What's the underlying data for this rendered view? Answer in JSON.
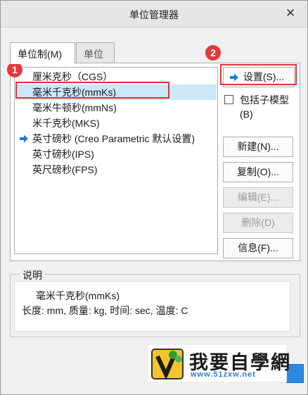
{
  "dialog": {
    "title": "单位管理器"
  },
  "tabs": [
    {
      "label": "单位制(M)",
      "active": true
    },
    {
      "label": "单位",
      "active": false
    }
  ],
  "unit_systems": [
    {
      "label": "厘米克秒（CGS）",
      "selected": false,
      "current": false
    },
    {
      "label": "毫米千克秒(mmKs)",
      "selected": true,
      "current": false
    },
    {
      "label": "毫米牛顿秒(mmNs)",
      "selected": false,
      "current": false
    },
    {
      "label": "米千克秒(MKS)",
      "selected": false,
      "current": false
    },
    {
      "label": "英寸磅秒 (Creo Parametric 默认设置)",
      "selected": false,
      "current": true
    },
    {
      "label": "英寸磅秒(IPS)",
      "selected": false,
      "current": false
    },
    {
      "label": "英尺磅秒(FPS)",
      "selected": false,
      "current": false
    }
  ],
  "buttons": {
    "settings": "设置(S)...",
    "new": "新建(N)...",
    "copy": "复制(O)...",
    "edit": "编辑(E)...",
    "delete": "删除(D)",
    "info": "信息(F)..."
  },
  "button_state": {
    "edit_enabled": false,
    "delete_enabled": false
  },
  "include_submodels": {
    "label": "包括子模型(B)",
    "checked": false
  },
  "description": {
    "legend": "说明",
    "name": "毫米千克秒(mmKs)",
    "details": "长度: mm, 质量: kg, 时间: sec, 温度: C"
  },
  "annotations": [
    {
      "number": "1"
    },
    {
      "number": "2"
    }
  ],
  "watermark": {
    "text": "我要自學網",
    "url": "www.51zxw.net"
  },
  "colors": {
    "accent_arrow": "#1f7ad6",
    "selection": "#cce8f8",
    "annotation": "#e0333a"
  }
}
